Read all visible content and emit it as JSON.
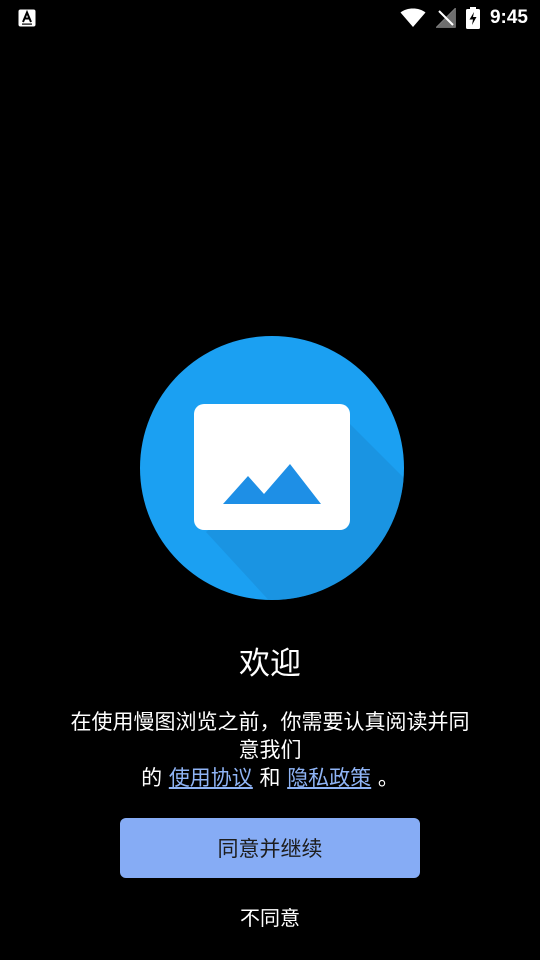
{
  "status_bar": {
    "time": "9:45",
    "left_icon": "accessibility-font-icon",
    "icons": [
      "wifi-icon",
      "no-signal-icon",
      "battery-charging-icon"
    ]
  },
  "logo": {
    "icon": "gallery-app-logo-icon",
    "circle_color": "#1ba0f2",
    "shadow_color": "#1a8ad6",
    "card_color": "#ffffff",
    "mountain_color": "#1e8fe6"
  },
  "welcome": {
    "title": "欢迎"
  },
  "message": {
    "line1": "在使用慢图浏览之前，你需要认真阅读并同意我们",
    "prefix": "的",
    "terms_link": "使用协议",
    "conjunction": "和",
    "privacy_link": "隐私政策",
    "suffix": "。"
  },
  "buttons": {
    "agree": "同意并继续",
    "disagree": "不同意"
  },
  "colors": {
    "background": "#000000",
    "link": "#8fb4f6",
    "agree_button_bg": "#86acf5"
  }
}
